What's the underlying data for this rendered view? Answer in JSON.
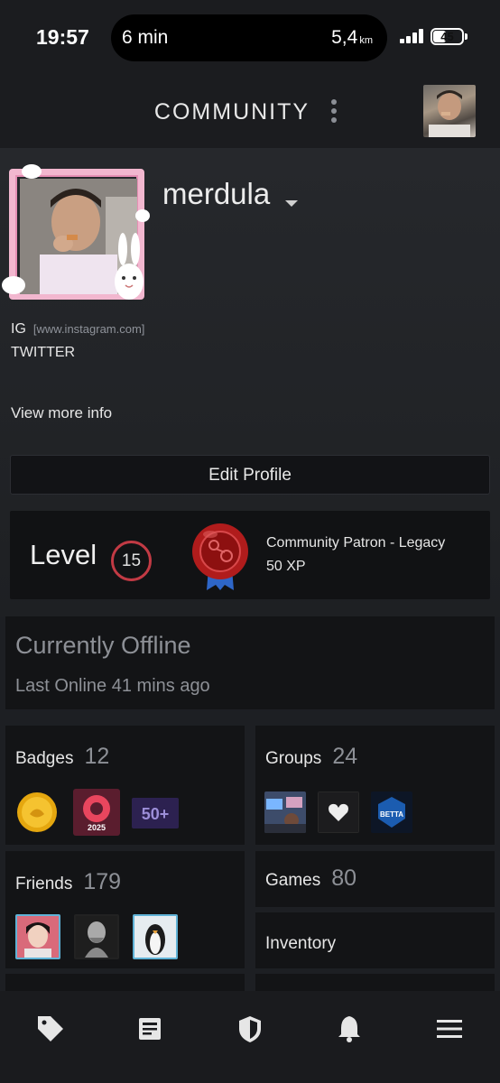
{
  "status_bar": {
    "time": "19:57",
    "island_left": "6 min",
    "island_distance": "5,4",
    "island_unit": "km",
    "battery": "45",
    "battery_level": 0.45
  },
  "header": {
    "title": "COMMUNITY",
    "menu_icon": "kebab-icon",
    "avatar_icon": "user-avatar"
  },
  "profile": {
    "username": "merdula",
    "links": {
      "ig_label": "IG",
      "ig_url": "[www.instagram.com]",
      "twitter_label": "TWITTER"
    },
    "view_more": "View more info",
    "edit_button": "Edit Profile"
  },
  "level": {
    "label": "Level",
    "value": "15",
    "badge_title": "Community Patron - Legacy",
    "badge_xp": "50 XP"
  },
  "status": {
    "state": "Currently Offline",
    "last_online": "Last Online 41 mins ago"
  },
  "tiles": {
    "badges": {
      "label": "Badges",
      "count": "12",
      "items": [
        "gold-coin-badge",
        "steam-2025-badge",
        "50-plus-badge"
      ],
      "year_text": "2025",
      "fifty_text": "50+"
    },
    "groups": {
      "label": "Groups",
      "count": "24",
      "items": [
        "gaming-room-group",
        "heart-group",
        "betta-group"
      ],
      "betta_text": "BETTA"
    },
    "friends": {
      "label": "Friends",
      "count": "179",
      "items": [
        "friend-girl-avatar",
        "friend-statue-avatar",
        "friend-penguin-avatar"
      ]
    },
    "games": {
      "label": "Games",
      "count": "80"
    },
    "inventory": {
      "label": "Inventory"
    }
  },
  "bottom_nav": [
    "tag-icon",
    "news-icon",
    "shield-icon",
    "bell-icon",
    "menu-icon"
  ],
  "colors": {
    "background": "#1d1f23",
    "card": "#131416",
    "level_ring": "#c23a44",
    "muted_text": "#8d9096",
    "frame_pink": "#f2b7cf"
  }
}
